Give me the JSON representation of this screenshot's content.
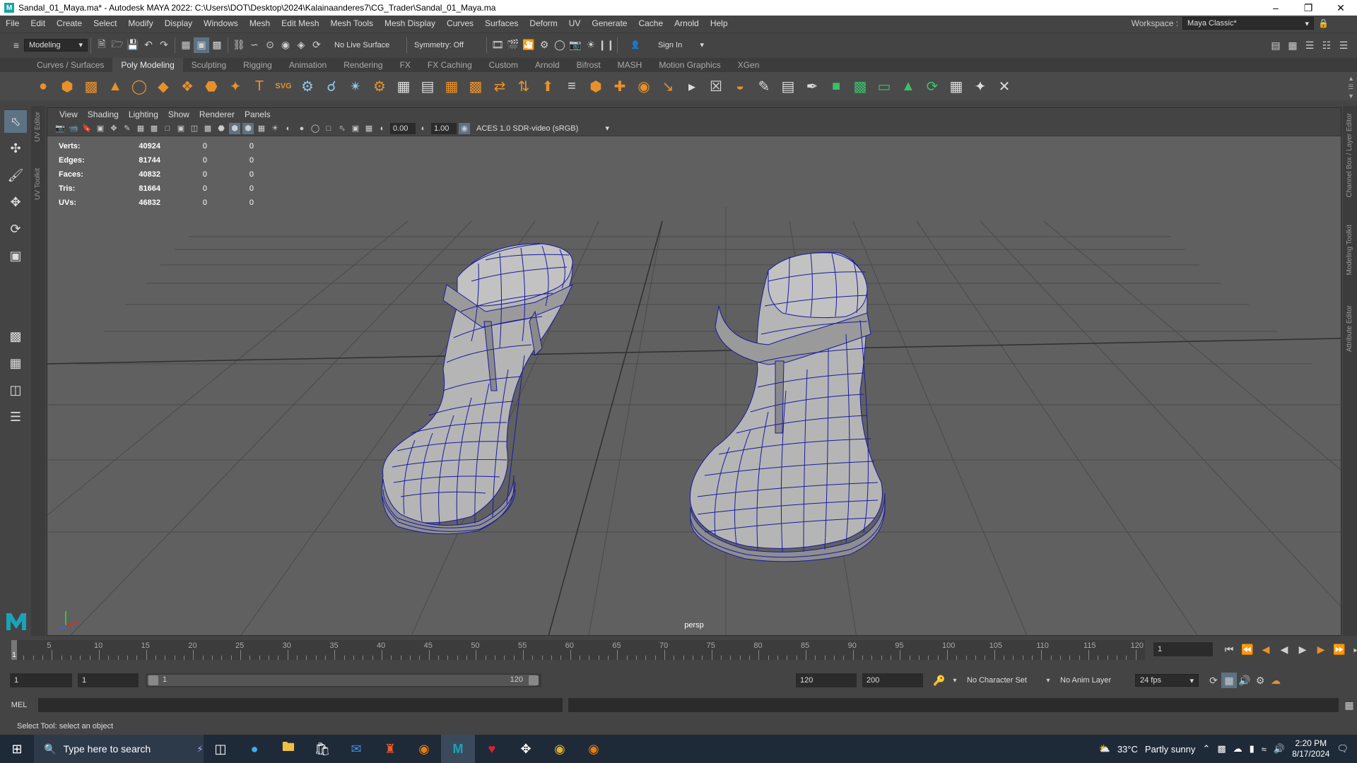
{
  "window": {
    "title": "Sandal_01_Maya.ma* - Autodesk MAYA 2022: C:\\Users\\DOT\\Desktop\\2024\\Kalainaanderes7\\CG_Trader\\Sandal_01_Maya.ma",
    "app_logo": "M"
  },
  "menubar": {
    "items": [
      "File",
      "Edit",
      "Create",
      "Select",
      "Modify",
      "Display",
      "Windows",
      "Mesh",
      "Edit Mesh",
      "Mesh Tools",
      "Mesh Display",
      "Curves",
      "Surfaces",
      "Deform",
      "UV",
      "Generate",
      "Cache",
      "Arnold",
      "Help"
    ],
    "workspace_label": "Workspace :",
    "workspace_value": "Maya Classic*"
  },
  "statusline": {
    "mode": "Modeling",
    "live_surface": "No Live Surface",
    "symmetry": "Symmetry: Off",
    "sign_in": "Sign In"
  },
  "shelf": {
    "tabs": [
      "Curves / Surfaces",
      "Poly Modeling",
      "Sculpting",
      "Rigging",
      "Animation",
      "Rendering",
      "FX",
      "FX Caching",
      "Custom",
      "Arnold",
      "Bifrost",
      "MASH",
      "Motion Graphics",
      "XGen"
    ],
    "active_tab": "Poly Modeling"
  },
  "side_labels": {
    "uv_editor": "UV Editor",
    "uv_toolkit": "UV Toolkit",
    "channel_box": "Channel Box / Layer Editor",
    "modeling_toolkit": "Modeling Toolkit",
    "attribute_editor": "Attribute Editor"
  },
  "viewport": {
    "menu": [
      "View",
      "Shading",
      "Lighting",
      "Show",
      "Renderer",
      "Panels"
    ],
    "exposure": "0.00",
    "gamma": "1.00",
    "color_space": "ACES 1.0 SDR-video (sRGB)",
    "camera_label": "persp",
    "hud": [
      {
        "label": "Verts:",
        "value": "40924",
        "sel": "0",
        "comp": "0"
      },
      {
        "label": "Edges:",
        "value": "81744",
        "sel": "0",
        "comp": "0"
      },
      {
        "label": "Faces:",
        "value": "40832",
        "sel": "0",
        "comp": "0"
      },
      {
        "label": "Tris:",
        "value": "81664",
        "sel": "0",
        "comp": "0"
      },
      {
        "label": "UVs:",
        "value": "46832",
        "sel": "0",
        "comp": "0"
      }
    ]
  },
  "timeslider": {
    "tick_labels": [
      "5",
      "10",
      "15",
      "20",
      "25",
      "30",
      "35",
      "40",
      "45",
      "50",
      "55",
      "60",
      "65",
      "70",
      "75",
      "80",
      "85",
      "90",
      "95",
      "100",
      "105",
      "110",
      "115",
      "120"
    ],
    "current_frame_marker": "1",
    "current_frame_field": "1"
  },
  "range": {
    "start": "1",
    "playback_start": "1",
    "range_start_label": "1",
    "range_end_label": "120",
    "playback_end": "120",
    "end": "200",
    "character_set": "No Character Set",
    "anim_layer": "No Anim Layer",
    "fps": "24 fps"
  },
  "mel": {
    "label": "MEL"
  },
  "helpline": {
    "text": "Select Tool: select an object"
  },
  "taskbar": {
    "search_placeholder": "Type here to search",
    "weather_temp": "33°C",
    "weather_text": "Partly sunny",
    "time": "2:20 PM",
    "date": "8/17/2024"
  },
  "colors": {
    "wire": "#1a1aa0",
    "viewport_bg": "#606060",
    "ui_bg": "#444444",
    "accent": "#5d7384"
  }
}
